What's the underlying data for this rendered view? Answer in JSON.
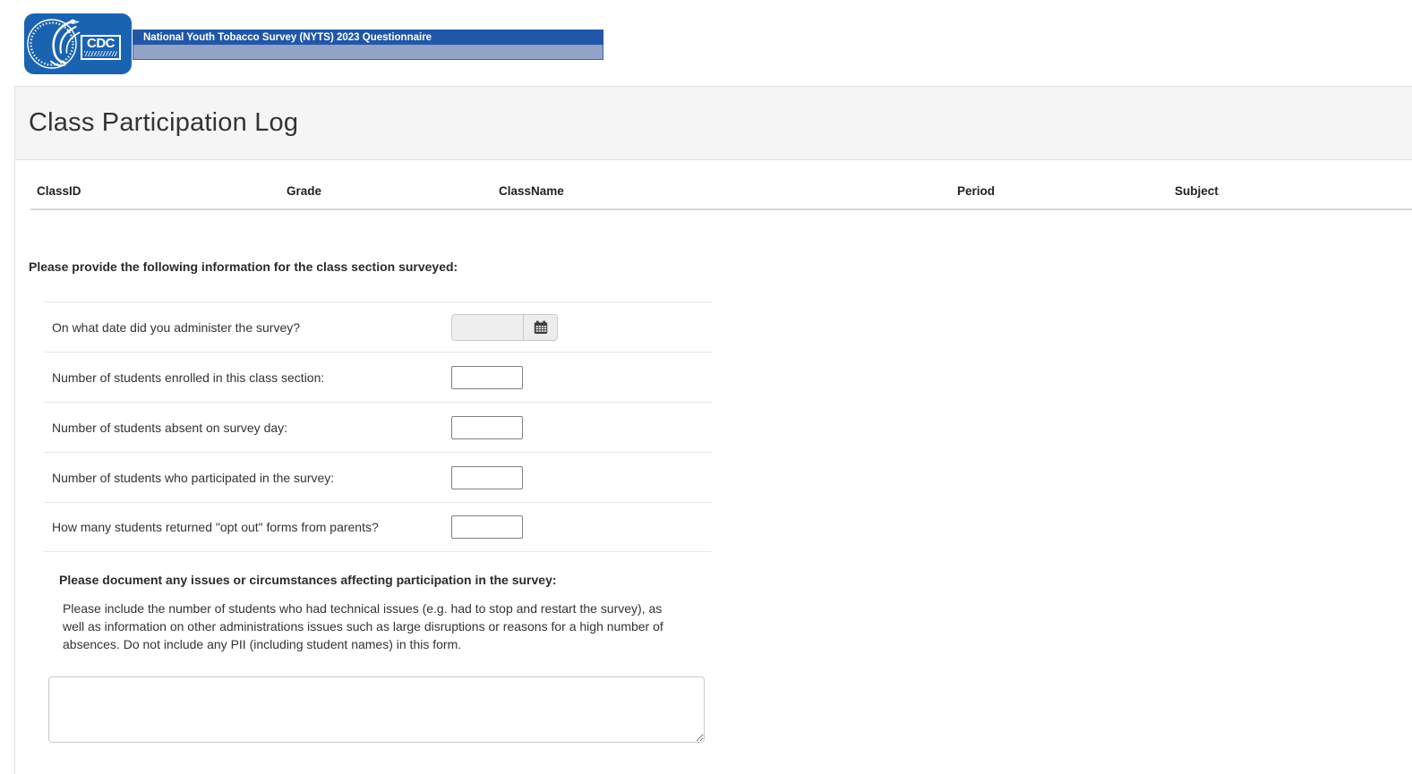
{
  "header": {
    "logo_text": "CDC",
    "banner_title": "National Youth Tobacco Survey (NYTS) 2023 Questionnaire"
  },
  "page": {
    "title": "Class Participation Log"
  },
  "class_table": {
    "columns": [
      "ClassID",
      "Grade",
      "ClassName",
      "Period",
      "Subject"
    ]
  },
  "form": {
    "section_heading": "Please provide the following information for the class section surveyed:",
    "questions": [
      {
        "label": "On what date did you administer the survey?",
        "type": "date",
        "value": ""
      },
      {
        "label": "Number of students enrolled in this class section:",
        "type": "number",
        "value": ""
      },
      {
        "label": "Number of students absent on survey day:",
        "type": "number",
        "value": ""
      },
      {
        "label": "Number of students who participated in the survey:",
        "type": "number",
        "value": ""
      },
      {
        "label": "How many students returned \"opt out\" forms from parents?",
        "type": "number",
        "value": ""
      }
    ],
    "issues_heading": "Please document any issues or circumstances affecting participation in the survey:",
    "issues_instructions": "Please include the number of students who had technical issues (e.g. had to stop and restart the survey), as well as information on other administrations issues such as large disruptions or reasons for a high number of absences. Do not include any PII (including student names) in this form.",
    "issues_value": ""
  },
  "icons": {
    "calendar": "calendar-icon",
    "eagle_seal": "hhs-eagle-icon"
  },
  "colors": {
    "logo_blue": "#1a63b0",
    "banner_dark_blue": "#2157a6",
    "banner_light_blue": "#93a2c7",
    "header_band_gray": "#f5f5f5",
    "border_gray": "#e0e0e0",
    "row_divider_gray": "#e7e7e7",
    "text": "#333333"
  }
}
